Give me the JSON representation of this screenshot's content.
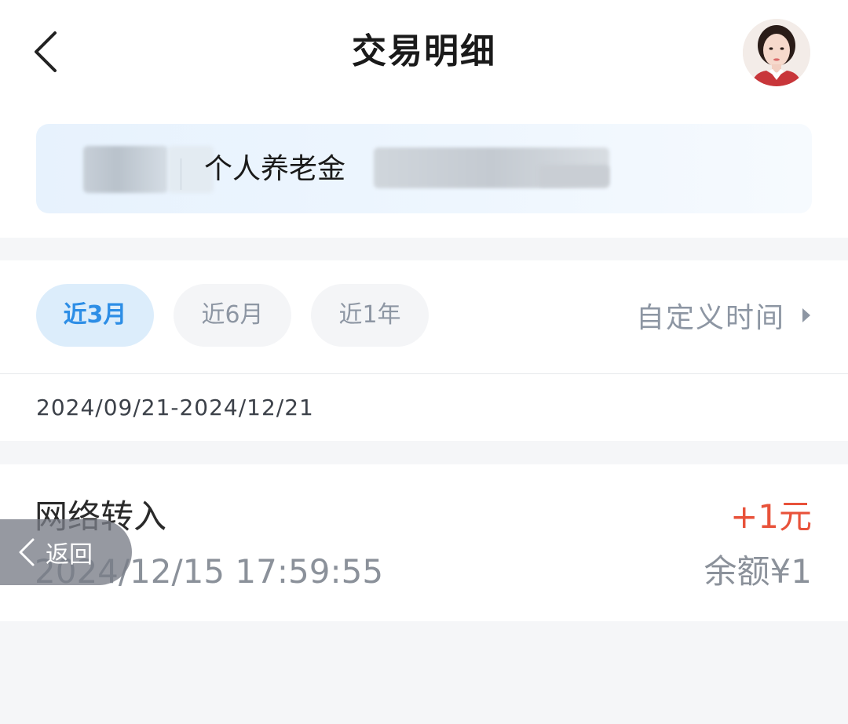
{
  "header": {
    "title": "交易明细",
    "back_icon": "chevron-left-icon",
    "avatar_icon": "customer-service-avatar"
  },
  "account": {
    "product_label": "个人养老金"
  },
  "filters": {
    "chips": [
      {
        "label": "近3月",
        "selected": true
      },
      {
        "label": "近6月",
        "selected": false
      },
      {
        "label": "近1年",
        "selected": false
      }
    ],
    "custom_time_label": "自定义时间",
    "custom_time_icon": "triangle-right-icon",
    "date_range": "2024/09/21-2024/12/21"
  },
  "transactions": [
    {
      "name": "网络转入",
      "time": "2024/12/15 17:59:55",
      "amount": "+1元",
      "balance": "余额¥1"
    }
  ],
  "float_back": {
    "label": "返回",
    "icon": "chevron-left-icon"
  },
  "colors": {
    "accent_blue": "#2d8ee6",
    "amount_red": "#e8523a",
    "muted_gray": "#8b919a",
    "page_bg": "#f5f6f8"
  }
}
